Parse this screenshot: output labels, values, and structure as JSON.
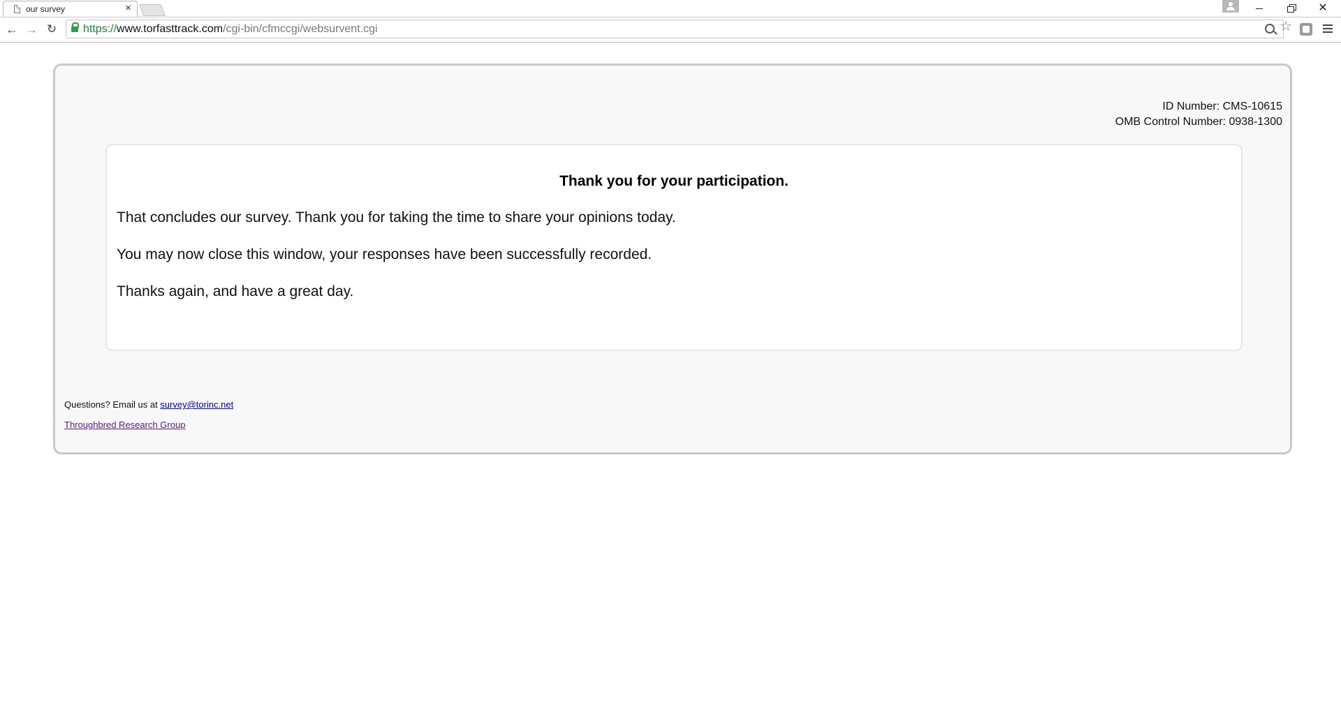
{
  "browser": {
    "tab_title": "our survey",
    "tab_close": "×",
    "url": {
      "scheme": "https://",
      "host": "www.torfasttrack.com",
      "path": "/cgi-bin/cfmccgi/websurvent.cgi"
    },
    "nav": {
      "back": "←",
      "forward": "→",
      "reload": "↻"
    },
    "star": "☆",
    "window": {
      "close": "✕"
    }
  },
  "page": {
    "id_number": "ID Number: CMS-10615",
    "omb_number": "OMB Control Number: 0938-1300",
    "heading": "Thank you for your participation.",
    "lines": [
      "That concludes our survey. Thank you for taking the time to share your opinions today.",
      "You may now close this window, your responses have been successfully recorded.",
      "Thanks again, and have a great day."
    ],
    "footer": {
      "questions_prefix": "Questions? Email us at ",
      "email": "survey@torinc.net",
      "org_link": "Throughbred Research Group"
    }
  },
  "colors": {
    "link": "#0000cc",
    "visited_link": "#551a8b",
    "secure_scheme": "#1b8a2c",
    "frame_border": "#c8c8c8",
    "frame_bg": "#f8f8f8"
  }
}
